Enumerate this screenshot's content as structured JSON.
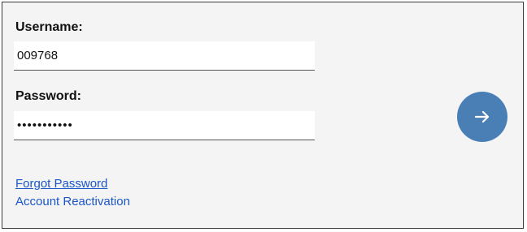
{
  "login": {
    "username_label": "Username:",
    "username_value": "009768",
    "password_label": "Password:",
    "password_value": "•••••••••••",
    "submit_icon": "arrow-right-icon",
    "accent_color": "#4a7fb5"
  },
  "links": {
    "forgot_password": "Forgot Password",
    "account_reactivation": "Account Reactivation",
    "link_color": "#1a56c8"
  }
}
